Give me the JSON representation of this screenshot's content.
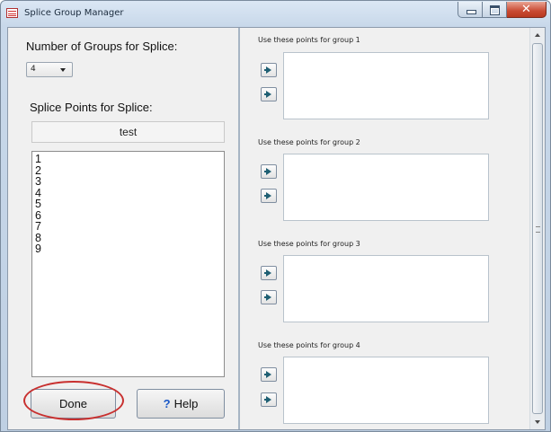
{
  "window": {
    "title": "Splice Group Manager"
  },
  "left_panel": {
    "groups_label": "Number of Groups for Splice:",
    "groups_value": "4",
    "points_label": "Splice Points for Splice:",
    "splice_name": "test",
    "points": [
      "1",
      "2",
      "3",
      "4",
      "5",
      "6",
      "7",
      "8",
      "9"
    ],
    "done_label": "Done",
    "help_label": "Help",
    "help_icon": "?"
  },
  "groups": [
    {
      "label": "Use these points for group 1"
    },
    {
      "label": "Use these points for group 2"
    },
    {
      "label": "Use these points for group 3"
    },
    {
      "label": "Use these points for group 4"
    }
  ],
  "icons": {
    "app": "splice-app-icon",
    "move": "arrow-right-icon"
  },
  "colors": {
    "highlight_ellipse": "#c8302f",
    "arrow": "#1e5f73"
  }
}
